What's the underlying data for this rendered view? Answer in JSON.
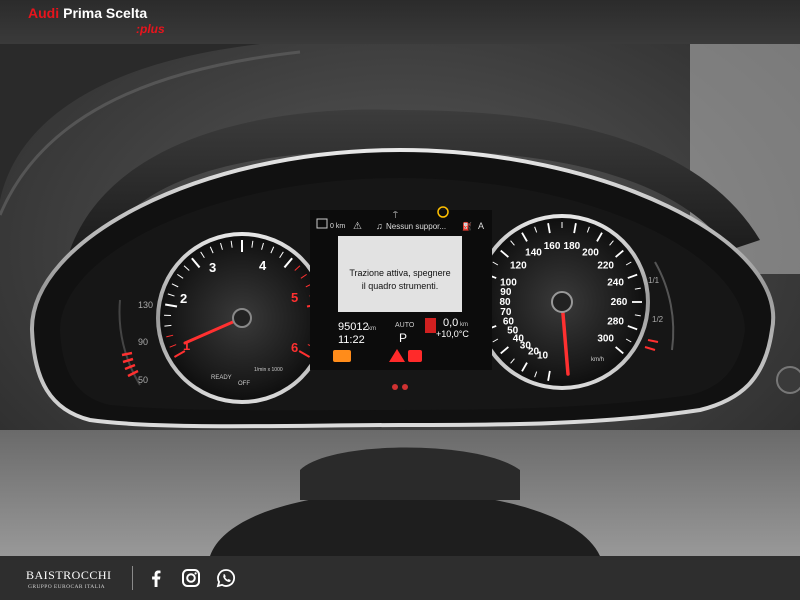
{
  "header": {
    "brand_audi": "Audi",
    "brand_text": "Prima Scelta",
    "brand_plus": ":plus"
  },
  "cluster": {
    "center_top": {
      "range": "0 km",
      "media": "Nessun suppor..."
    },
    "message": {
      "line1": "Trazione attiva, spegnere",
      "line2": "il quadro strumenti."
    },
    "odometer": "95012",
    "odometer_unit": "km",
    "clock": "11:22",
    "gear_mode": "AUTO",
    "gear": "P",
    "trip": "0,0",
    "trip_unit": "km",
    "temperature": "+10,0°C",
    "tach": {
      "labels": [
        "1",
        "2",
        "3",
        "4",
        "5",
        "6"
      ],
      "ready": "READY",
      "off": "OFF",
      "unit": "1/min x 1000",
      "needle_value": 0
    },
    "speedo": {
      "labels": [
        "10",
        "20",
        "30",
        "40",
        "50",
        "60",
        "70",
        "80",
        "90",
        "100",
        "120",
        "140",
        "160",
        "180",
        "200",
        "220",
        "240",
        "260",
        "280",
        "300"
      ],
      "unit": "km/h",
      "needle_value": 0
    },
    "temp_gauge_labels": [
      "50",
      "90",
      "130"
    ],
    "fuel_gauge_labels": [
      "1/1",
      "1/2"
    ]
  },
  "footer": {
    "dealer_name": "BAISTROCCHI",
    "dealer_sub": "GRUPPO EUROCAR ITALIA",
    "icons": [
      "facebook-icon",
      "instagram-icon",
      "whatsapp-icon"
    ]
  },
  "colors": {
    "audi_red": "#e8141c",
    "warning_amber": "#ff8c1a",
    "warning_red": "#ff2a2a",
    "needle_red": "#ff3030"
  }
}
